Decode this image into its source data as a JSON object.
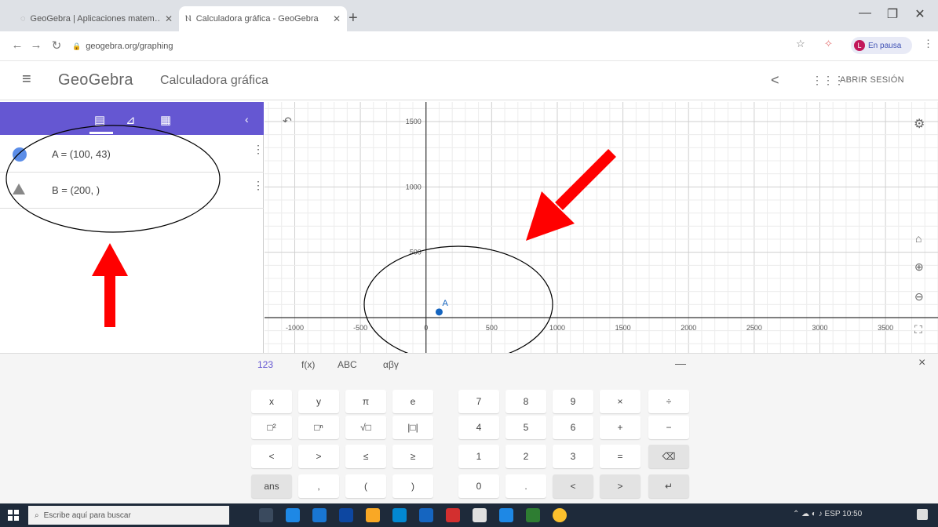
{
  "browser": {
    "tabs": [
      {
        "title": "GeoGebra | Aplicaciones matem…",
        "active": false
      },
      {
        "title": "Calculadora gráfica - GeoGebra",
        "active": true
      }
    ],
    "new_tab": "+",
    "url": "geogebra.org/graphing",
    "profile_label": "En pausa",
    "profile_initial": "L"
  },
  "header": {
    "brand": "GeoGebra",
    "title": "Calculadora gráfica",
    "signin": "ABRIR SESIÓN"
  },
  "algebra": {
    "rows": [
      {
        "text": "A = (100, 43)",
        "marker": "point"
      },
      {
        "text": "B = (200, )",
        "marker": "warning"
      }
    ]
  },
  "graph": {
    "x_ticks": [
      -1000,
      -500,
      0,
      500,
      1000,
      1500,
      2000,
      2500,
      3000,
      3500
    ],
    "y_ticks": [
      500,
      1000,
      1500
    ],
    "xlim": [
      -1230,
      3900
    ],
    "ylim": [
      -270,
      1650
    ],
    "point": {
      "label": "A",
      "x": 100,
      "y": 43,
      "color": "#1565c0"
    }
  },
  "annotations": {
    "color": "#ff0000"
  },
  "keyboard": {
    "tabs": [
      "123",
      "f(x)",
      "ABC",
      "αβγ"
    ],
    "minimize": "—",
    "close": "×",
    "rows": [
      [
        "x",
        "y",
        "π",
        "e",
        "7",
        "8",
        "9",
        "×",
        "÷"
      ],
      [
        "□²",
        "□ⁿ",
        "√□",
        "|□|",
        "4",
        "5",
        "6",
        "+",
        "−"
      ],
      [
        "<",
        ">",
        "≤",
        "≥",
        "1",
        "2",
        "3",
        "=",
        "⌫"
      ],
      [
        "ans",
        ",",
        "(",
        ")",
        "0",
        ".",
        "<",
        ">",
        "↵"
      ]
    ]
  },
  "taskbar": {
    "search_placeholder": "Escribe aquí para buscar",
    "lang": "ESP",
    "time": "10:50"
  }
}
